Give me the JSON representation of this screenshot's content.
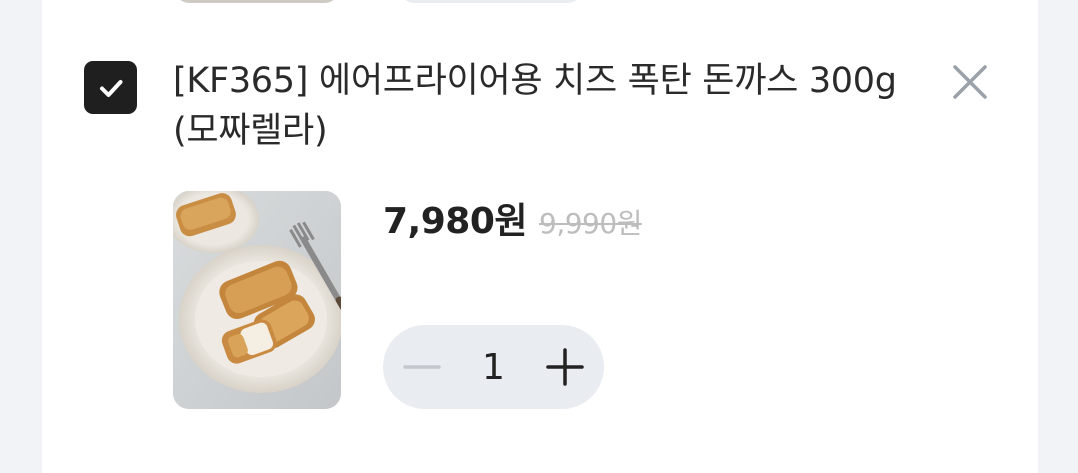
{
  "item": {
    "selected": true,
    "title": "[KF365] 에어프라이어용 치즈 폭탄 돈까스 300g (모짜렐라)",
    "price_current": "7,980원",
    "price_original": "9,990원",
    "quantity": "1",
    "thumbnail_icon": "product-photo-cheese-cutlet"
  },
  "colors": {
    "checkbox_bg": "#1f1f1f",
    "stepper_bg": "#e9ecf1",
    "page_bg": "#f1f3f6",
    "strike_price": "#bdbdbd",
    "remove_icon": "#9aa1a9"
  },
  "icons": {
    "checkbox": "check-icon",
    "remove": "close-icon",
    "decrease": "minus-icon",
    "increase": "plus-icon"
  }
}
